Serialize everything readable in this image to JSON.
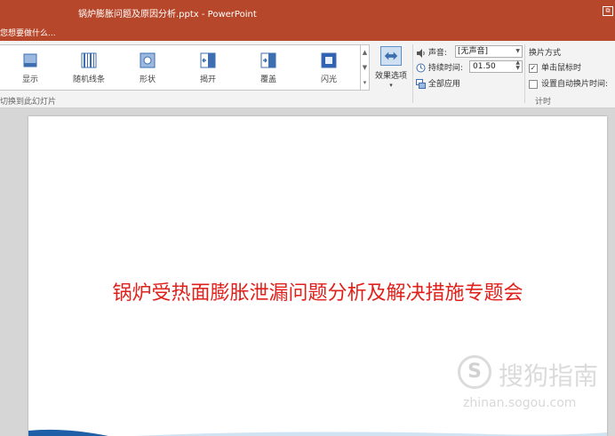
{
  "window": {
    "title": "锅炉膨胀问题及原因分析.pptx - PowerPoint",
    "restore_glyph": "⧉"
  },
  "tell_me": {
    "placeholder": "您想要做什么..."
  },
  "transitions_gallery": {
    "items": [
      {
        "label": "显示",
        "icon": "appear-icon"
      },
      {
        "label": "随机线条",
        "icon": "random-bars-icon"
      },
      {
        "label": "形状",
        "icon": "shape-icon"
      },
      {
        "label": "揭开",
        "icon": "uncover-icon"
      },
      {
        "label": "覆盖",
        "icon": "cover-icon"
      },
      {
        "label": "闪光",
        "icon": "flash-icon"
      }
    ],
    "scroll_up": "▲",
    "scroll_down": "▼",
    "more": "▾",
    "group_label": "切换到此幻灯片"
  },
  "effect_options": {
    "label": "效果选项",
    "arrow": "▾",
    "icon": "effect-options-icon"
  },
  "timing": {
    "sound_label": "声音:",
    "sound_value": "[无声音]",
    "duration_label": "持续时间:",
    "duration_value": "01.50",
    "apply_all_label": "全部应用",
    "group_label": "计时",
    "advance_title": "换片方式",
    "on_click_label": "单击鼠标时",
    "on_click_checked": true,
    "after_label": "设置自动换片时间:",
    "after_checked": false
  },
  "slide": {
    "title": "锅炉受热面膨胀泄漏问题分析及解决措施专题会"
  },
  "watermark": {
    "logo": "S",
    "text": "搜狗指南",
    "url": "zhinan.sogou.com"
  },
  "colors": {
    "accent": "#b7472a",
    "slide_title": "#e0201a",
    "wave": "#1f5fa8"
  }
}
